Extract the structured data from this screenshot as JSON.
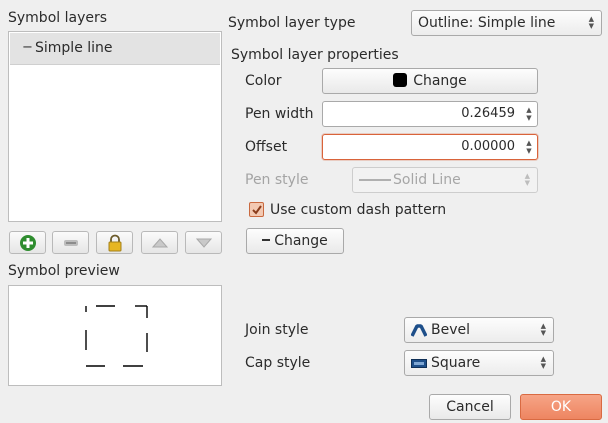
{
  "left": {
    "layers_title": "Symbol layers",
    "layers": [
      {
        "label": "Simple line",
        "expander": "−"
      }
    ],
    "toolbar": [
      {
        "name": "add-layer-button",
        "icon": "add-icon"
      },
      {
        "name": "remove-layer-button",
        "icon": "remove-icon"
      },
      {
        "name": "lock-layer-button",
        "icon": "lock-icon"
      },
      {
        "name": "move-up-button",
        "icon": "up-arrow-icon"
      },
      {
        "name": "move-down-button",
        "icon": "down-arrow-icon"
      }
    ],
    "preview_title": "Symbol preview"
  },
  "right": {
    "type_label": "Symbol layer type",
    "type_value": "Outline: Simple line",
    "props_title": "Symbol layer properties",
    "color_label": "Color",
    "color_button": "Change",
    "color_value": "#000000",
    "pen_width_label": "Pen width",
    "pen_width_value": "0.26459",
    "offset_label": "Offset",
    "offset_value": "0.00000",
    "pen_style_label": "Pen style",
    "pen_style_value": "Solid Line",
    "custom_dash_label": "Use custom dash pattern",
    "custom_dash_checked": true,
    "dash_change_button": "Change",
    "join_style_label": "Join style",
    "join_style_value": "Bevel",
    "cap_style_label": "Cap style",
    "cap_style_value": "Square"
  },
  "footer": {
    "cancel_button": "Cancel",
    "ok_button": "OK"
  },
  "colors": {
    "accent": "#ee8561",
    "focus_border": "#d9633a",
    "checkbox_fill": "#f3c9b2"
  }
}
